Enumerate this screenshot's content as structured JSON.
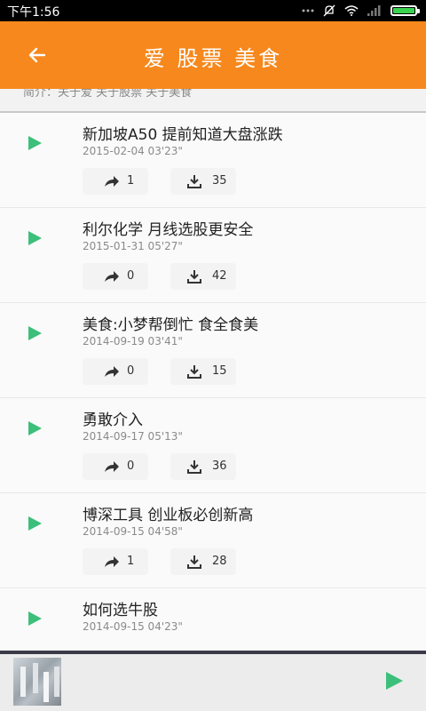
{
  "status_bar": {
    "time": "下午1:56"
  },
  "header": {
    "title": "爱 股票 美食"
  },
  "intro": {
    "text": "简介：关于爱 关于股票 关于美食"
  },
  "colors": {
    "accent": "#f6881d",
    "play": "#3cbf7a"
  },
  "items": [
    {
      "title": "新加坡A50 提前知道大盘涨跌",
      "date": "2015-02-04  03'23\"",
      "shares": "1",
      "downloads": "35"
    },
    {
      "title": "利尔化学 月线选股更安全",
      "date": "2015-01-31  05'27\"",
      "shares": "0",
      "downloads": "42"
    },
    {
      "title": "美食:小梦帮倒忙 食全食美",
      "date": "2014-09-19  03'41\"",
      "shares": "0",
      "downloads": "15"
    },
    {
      "title": "勇敢介入",
      "date": "2014-09-17  05'13\"",
      "shares": "0",
      "downloads": "36"
    },
    {
      "title": "博深工具 创业板必创新高",
      "date": "2014-09-15  04'58\"",
      "shares": "1",
      "downloads": "28"
    },
    {
      "title": "如何选牛股",
      "date": "2014-09-15  04'23\"",
      "shares": "",
      "downloads": ""
    }
  ]
}
